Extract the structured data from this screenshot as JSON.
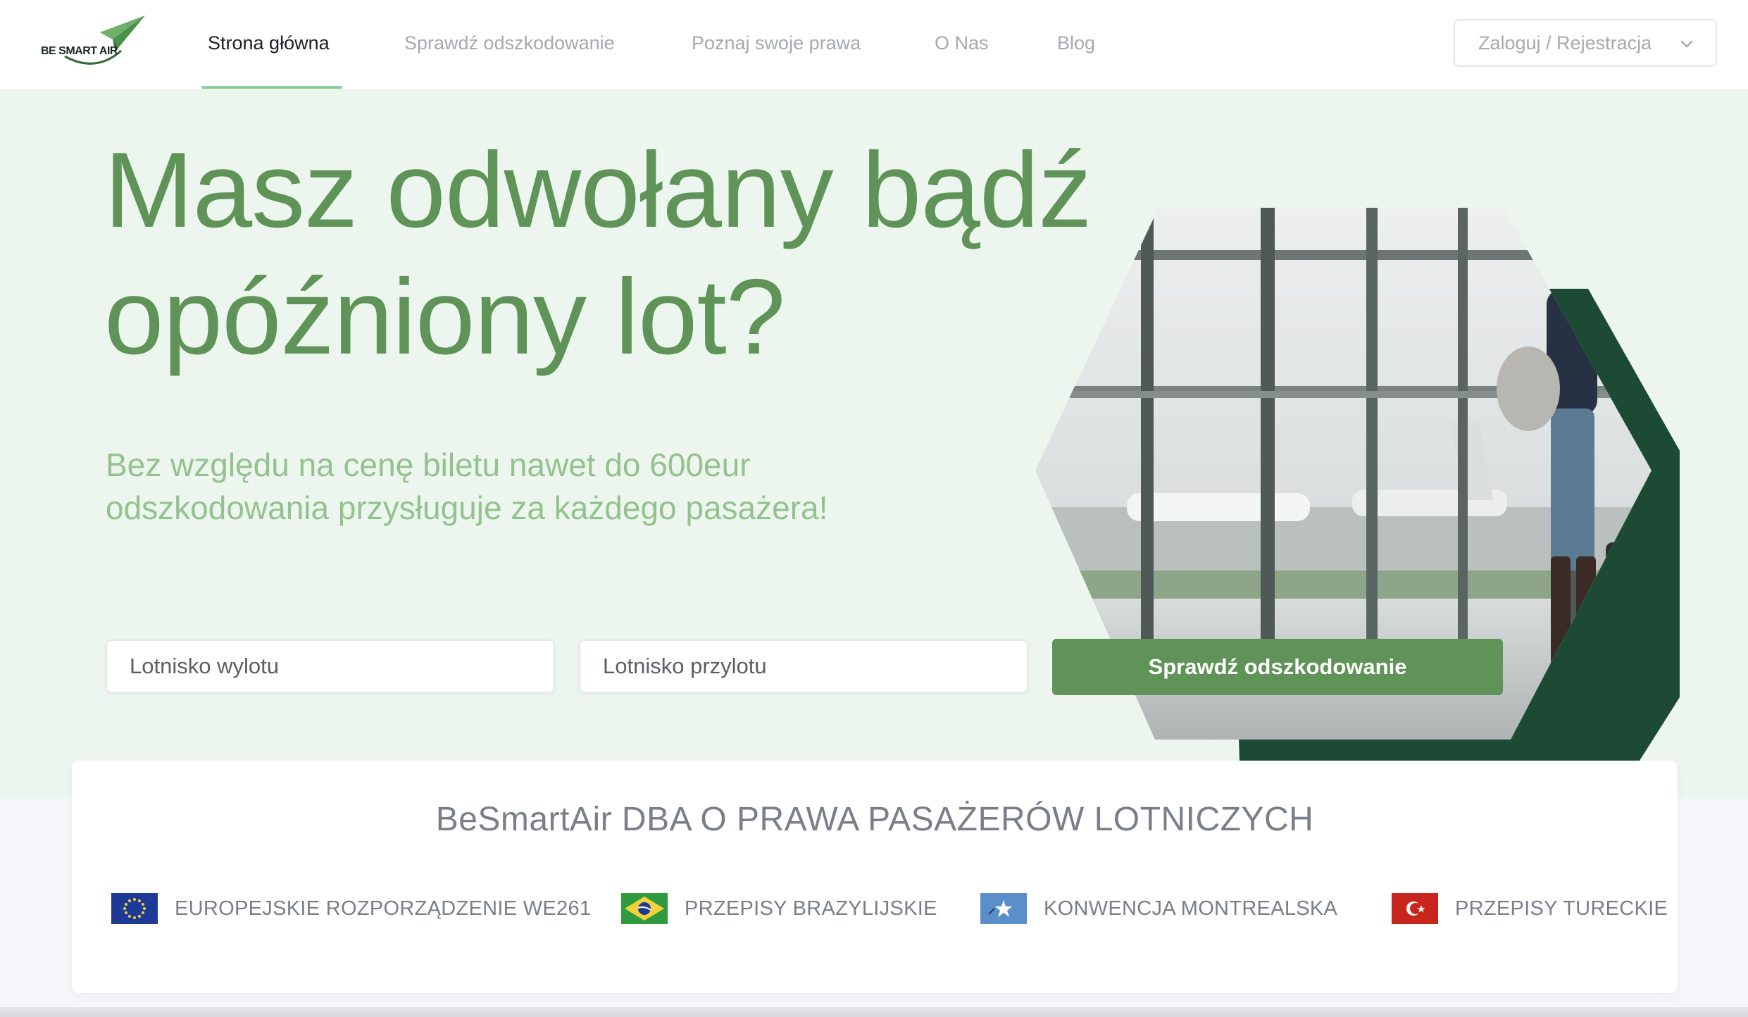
{
  "header": {
    "logo_text": "BE SMART AIR",
    "nav": [
      {
        "label": "Strona główna",
        "active": true
      },
      {
        "label": "Sprawdź odszkodowanie",
        "active": false
      },
      {
        "label": "Poznaj swoje prawa",
        "active": false
      },
      {
        "label": "O Nas",
        "active": false
      },
      {
        "label": "Blog",
        "active": false
      }
    ],
    "login_label": "Zaloguj / Rejestracja"
  },
  "hero": {
    "title_line1": "Masz odwołany bądź",
    "title_line2": "opóźniony lot?",
    "subtitle": "Bez względu na cenę biletu nawet do 600eur odszkodowania przysługuje za każdego pasażera!",
    "departure_placeholder": "Lotnisko wylotu",
    "arrival_placeholder": "Lotnisko przylotu",
    "cta_label": "Sprawdź odszkodowanie"
  },
  "info": {
    "title": "BeSmartAir DBA O PRAWA PASAŻERÓW LOTNICZYCH",
    "laws": [
      {
        "label": "EUROPEJSKIE ROZPORZĄDZENIE WE261",
        "flag": "eu-flag-icon"
      },
      {
        "label": "PRZEPISY BRAZYLIJSKIE",
        "flag": "brazil-flag-icon"
      },
      {
        "label": "KONWENCJA MONTREALSKA",
        "flag": "montreal-flag-icon"
      },
      {
        "label": "PRZEPISY TURECKIE",
        "flag": "turkey-flag-icon"
      }
    ]
  },
  "colors": {
    "brand_green": "#5f9357",
    "dark_green": "#1d4a34",
    "hero_bg": "#edf6ee",
    "light_green_text": "#94c28e"
  }
}
